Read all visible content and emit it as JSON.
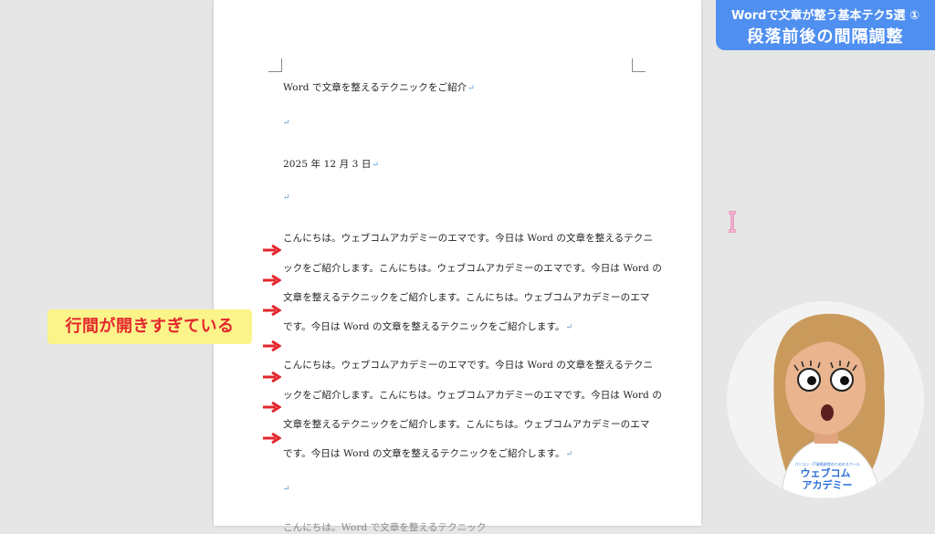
{
  "header": {
    "title_line1": "Wordで文章が整う基本テク5選 ①",
    "title_line2": "段落前後の間隔調整"
  },
  "callout": {
    "text": "行間が開きすぎている"
  },
  "document": {
    "paragraph_mark": "↵",
    "title": "Word で文章を整えるテクニックをご紹介",
    "date": "2025 年 12 月 3 日",
    "para1": [
      "こんにちは。ウェブコムアカデミーのエマです。今日は Word の文章を整えるテクニ",
      "ックをご紹介します。こんにちは。ウェブコムアカデミーのエマです。今日は Word の",
      "文章を整えるテクニックをご紹介します。こんにちは。ウェブコムアカデミーのエマ",
      "です。今日は Word の文章を整えるテクニックをご紹介します。"
    ],
    "para2": [
      "こんにちは。ウェブコムアカデミーのエマです。今日は Word の文章を整えるテクニ",
      "ックをご紹介します。こんにちは。ウェブコムアカデミーのエマです。今日は Word の",
      "文章を整えるテクニックをご紹介します。こんにちは。ウェブコムアカデミーのエマ",
      "です。今日は Word の文章を整えるテクニックをご紹介します。"
    ],
    "last_line": "こんにちは。Word で文章を整えるテクニック"
  },
  "avatar": {
    "shirt_text_top": "パソコン・IT資格取得のためのスクール",
    "shirt_text_1": "ウェブコム",
    "shirt_text_2": "アカデミー"
  },
  "colors": {
    "title_bg": "#4f8ff0",
    "callout_bg": "#fbf48a",
    "callout_text": "#e3262d",
    "arrow": "#e3262d",
    "paragraph_mark": "#5b9bd5"
  }
}
